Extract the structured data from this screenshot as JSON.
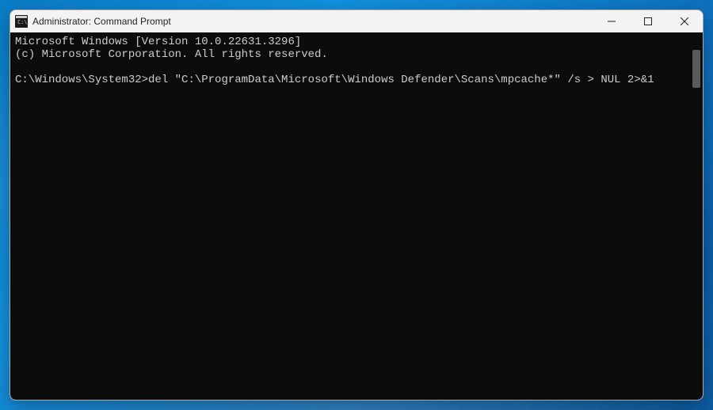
{
  "window": {
    "title": "Administrator: Command Prompt"
  },
  "terminal": {
    "line1": "Microsoft Windows [Version 10.0.22631.3296]",
    "line2": "(c) Microsoft Corporation. All rights reserved.",
    "blank": "",
    "prompt": "C:\\Windows\\System32>",
    "command": "del \"C:\\ProgramData\\Microsoft\\Windows Defender\\Scans\\mpcache*\" /s > NUL 2>&1"
  }
}
